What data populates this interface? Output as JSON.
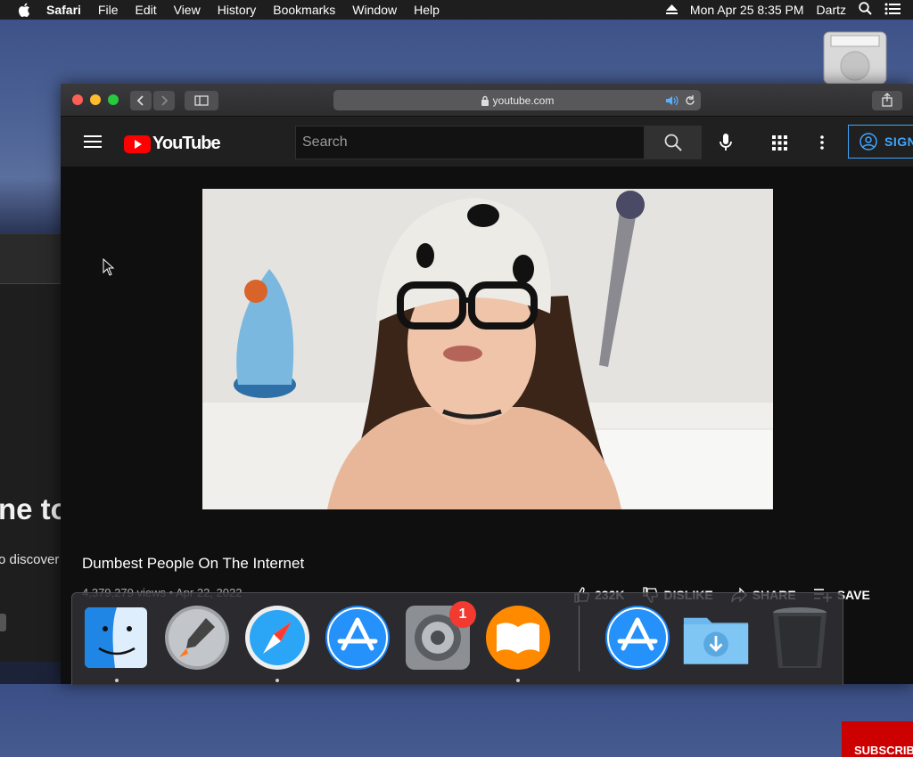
{
  "menubar": {
    "app_name": "Safari",
    "items": [
      "File",
      "Edit",
      "View",
      "History",
      "Bookmarks",
      "Window",
      "Help"
    ],
    "datetime": "Mon Apr 25  8:35 PM",
    "user": "Dartz"
  },
  "background_window": {
    "heading_fragment": "ne to",
    "body_fragment": "o discover"
  },
  "safari": {
    "url": "youtube.com"
  },
  "youtube": {
    "logo_text": "YouTube",
    "search_placeholder": "Search",
    "signin_label": "SIGN",
    "video_title": "Dumbest People On The Internet",
    "video_stats": "4,379,279 views • Apr 22, 2022",
    "like_label": "232K",
    "dislike_label": "DISLIKE",
    "share_label": "SHARE",
    "save_label": "SAVE",
    "subscribe_label": "SUBSCRIBE"
  },
  "dock": {
    "items": [
      "finder-icon",
      "launchpad-icon",
      "safari-icon",
      "app-store-icon",
      "system-preferences-icon",
      "books-icon",
      "app-store-download-icon",
      "downloads-folder-icon",
      "trash-icon"
    ],
    "badge_count": "1"
  },
  "colors": {
    "youtube_red": "#ff0000",
    "signin_blue": "#3ea6ff",
    "menubar_bg": "#1e1e1e"
  }
}
